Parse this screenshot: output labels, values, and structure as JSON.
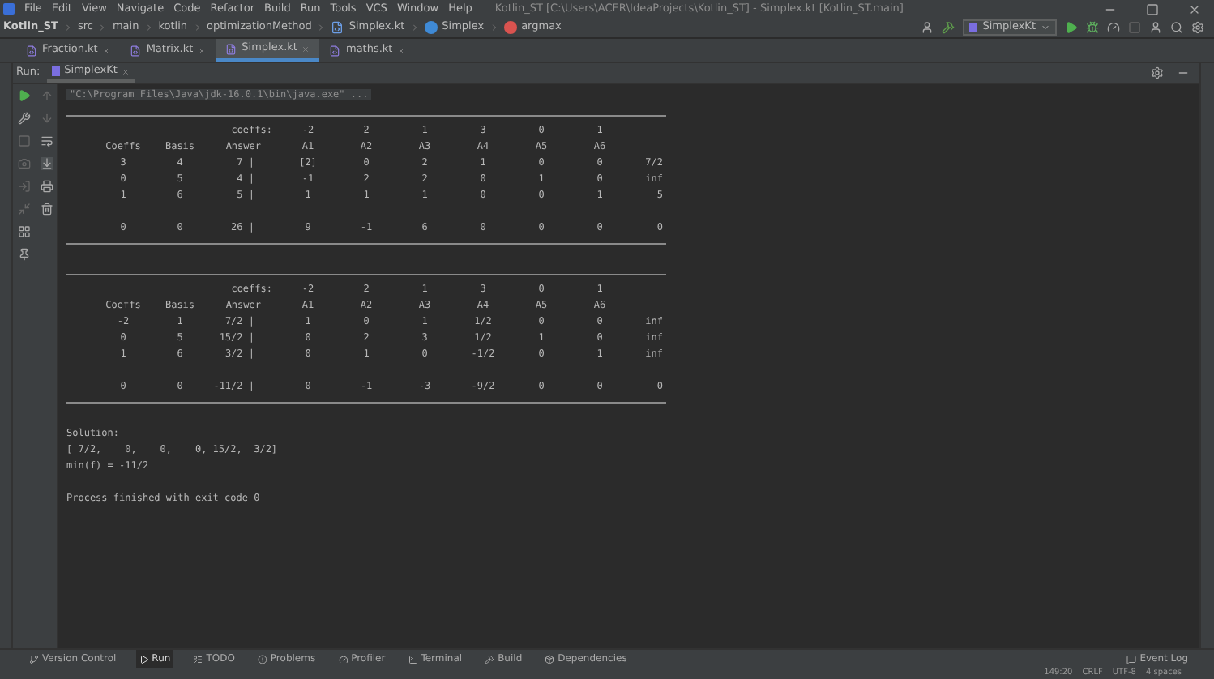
{
  "window": {
    "title": "Kotlin_ST [C:\\Users\\ACER\\IdeaProjects\\Kotlin_ST] - Simplex.kt [Kotlin_ST.main]"
  },
  "menu": [
    "File",
    "Edit",
    "View",
    "Navigate",
    "Code",
    "Refactor",
    "Build",
    "Run",
    "Tools",
    "VCS",
    "Window",
    "Help"
  ],
  "breadcrumbs": [
    {
      "label": "Kotlin_ST",
      "kind": "project"
    },
    {
      "label": "src",
      "kind": "folder"
    },
    {
      "label": "main",
      "kind": "folder"
    },
    {
      "label": "kotlin",
      "kind": "folder"
    },
    {
      "label": "optimizationMethod",
      "kind": "folder"
    },
    {
      "label": "Simplex.kt",
      "kind": "file"
    },
    {
      "label": "Simplex",
      "kind": "class"
    },
    {
      "label": "argmax",
      "kind": "method"
    }
  ],
  "run_config": "SimplexKt",
  "editor_tabs": [
    {
      "label": "Fraction.kt",
      "selected": false
    },
    {
      "label": "Matrix.kt",
      "selected": false
    },
    {
      "label": "Simplex.kt",
      "selected": true
    },
    {
      "label": "maths.kt",
      "selected": false
    }
  ],
  "run_panel": {
    "title": "Run:",
    "tab": "SimplexKt"
  },
  "console": {
    "command": "\"C:\\Program Files\\Java\\jdk-16.0.1\\bin\\java.exe\" ...",
    "tableaus": [
      {
        "coeffs_label": "coeffs:",
        "coeffs": [
          "-2",
          "2",
          "1",
          "3",
          "0",
          "1"
        ],
        "headers": [
          "Coeffs",
          "Basis",
          "Answer",
          "A1",
          "A2",
          "A3",
          "A4",
          "A5",
          "A6"
        ],
        "rows": [
          [
            "3",
            "4",
            "7 |",
            "[2]",
            "0",
            "2",
            "1",
            "0",
            "0",
            "7/2"
          ],
          [
            "0",
            "5",
            "4 |",
            "-1",
            "2",
            "2",
            "0",
            "1",
            "0",
            "inf"
          ],
          [
            "1",
            "6",
            "5 |",
            "1",
            "1",
            "1",
            "0",
            "0",
            "1",
            "5"
          ]
        ],
        "delta": [
          "0",
          "0",
          "26 |",
          "9",
          "-1",
          "6",
          "0",
          "0",
          "0",
          "0"
        ]
      },
      {
        "coeffs_label": "coeffs:",
        "coeffs": [
          "-2",
          "2",
          "1",
          "3",
          "0",
          "1"
        ],
        "headers": [
          "Coeffs",
          "Basis",
          "Answer",
          "A1",
          "A2",
          "A3",
          "A4",
          "A5",
          "A6"
        ],
        "rows": [
          [
            "-2",
            "1",
            "7/2 |",
            "1",
            "0",
            "1",
            "1/2",
            "0",
            "0",
            "inf"
          ],
          [
            "0",
            "5",
            "15/2 |",
            "0",
            "2",
            "3",
            "1/2",
            "1",
            "0",
            "inf"
          ],
          [
            "1",
            "6",
            "3/2 |",
            "0",
            "1",
            "0",
            "-1/2",
            "0",
            "1",
            "inf"
          ]
        ],
        "delta": [
          "0",
          "0",
          "-11/2 |",
          "0",
          "-1",
          "-3",
          "-9/2",
          "0",
          "0",
          "0"
        ]
      }
    ],
    "output": [
      "Solution:",
      "[ 7/2,    0,    0,    0, 15/2,  3/2]",
      "min(f) = -11/2"
    ],
    "exit_line": "Process finished with exit code 0"
  },
  "tool_windows": [
    {
      "label": "Version Control",
      "selected": false
    },
    {
      "label": "Run",
      "selected": true
    },
    {
      "label": "TODO",
      "selected": false
    },
    {
      "label": "Problems",
      "selected": false
    },
    {
      "label": "Profiler",
      "selected": false
    },
    {
      "label": "Terminal",
      "selected": false
    },
    {
      "label": "Build",
      "selected": false
    },
    {
      "label": "Dependencies",
      "selected": false
    }
  ],
  "event_log": "Event Log",
  "status_bar": [
    "149:20",
    "CRLF",
    "UTF-8",
    "4 spaces"
  ]
}
